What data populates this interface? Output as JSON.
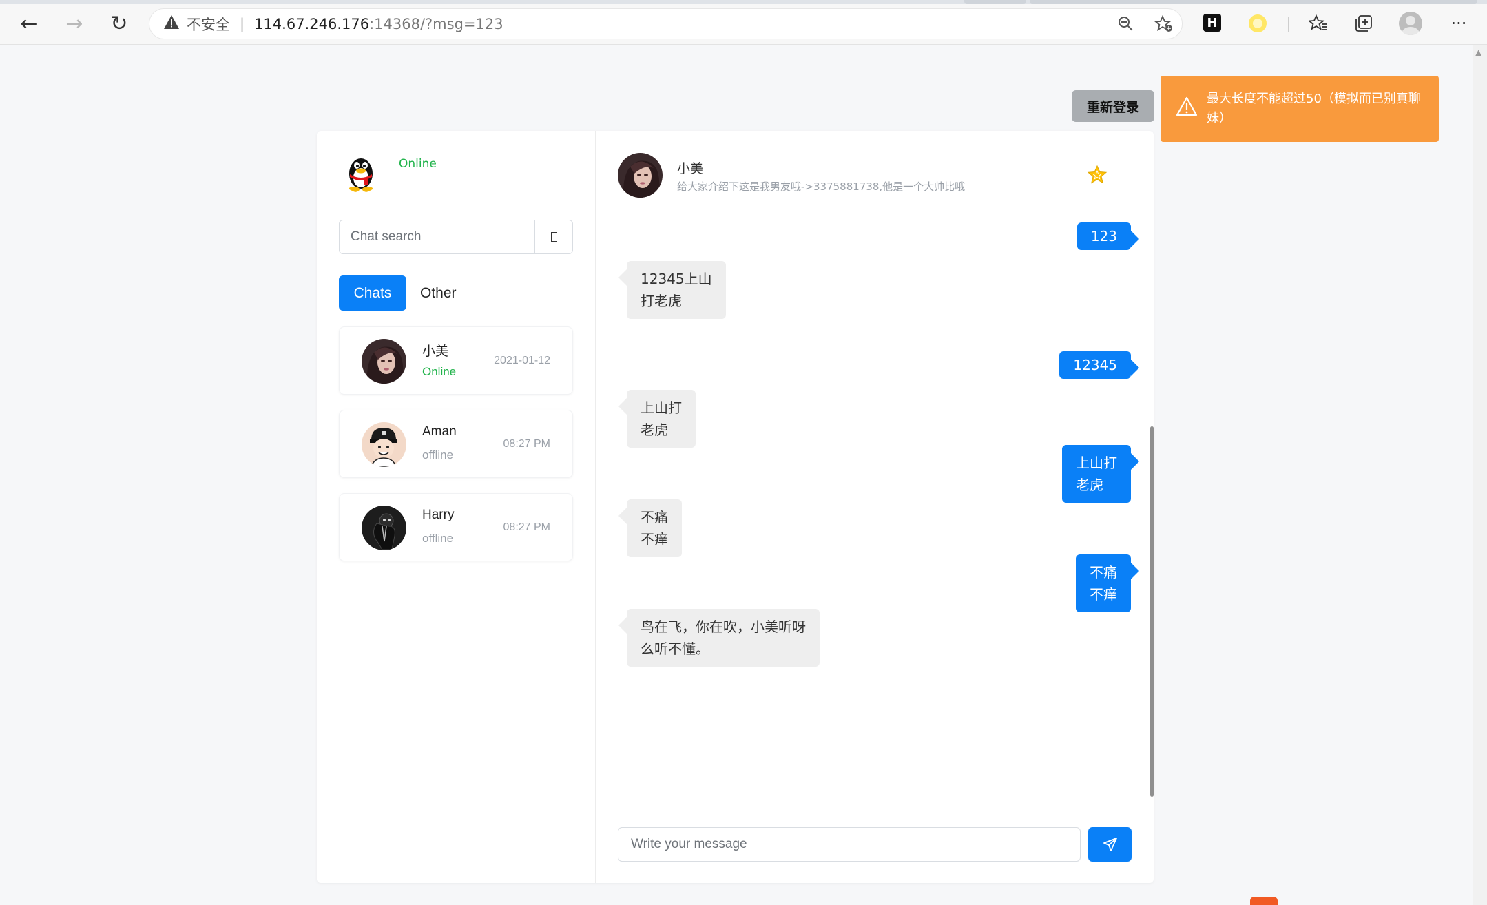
{
  "browser": {
    "nav": {
      "back": "←",
      "forward": "→",
      "reload": "↻"
    },
    "address": {
      "insecure_label": "不安全",
      "separator": "|",
      "host": "114.67.246.176",
      "path": ":14368/?msg=123"
    },
    "icons": [
      "zoom-icon",
      "add-favorite-icon",
      "h-extension-icon",
      "yellow-extension-icon",
      "favorites-icon",
      "collections-icon",
      "profile-icon",
      "more-icon"
    ]
  },
  "relogin_label": "重新登录",
  "toast": {
    "text": "最大长度不能超过50（模拟而已别真聊妹）"
  },
  "me": {
    "status": "Online"
  },
  "search": {
    "placeholder": "Chat search"
  },
  "tabs": [
    {
      "label": "Chats"
    },
    {
      "label": "Other"
    }
  ],
  "contacts": [
    {
      "name": "小美",
      "status": "Online",
      "time": "2021-01-12"
    },
    {
      "name": "Aman",
      "status": "offline",
      "time": "08:27 PM"
    },
    {
      "name": "Harry",
      "status": "offline",
      "time": "08:27 PM"
    }
  ],
  "chat": {
    "name": "小美",
    "signature": "给大家介绍下这是我男友哦->3375881738,他是一个大帅比哦",
    "messages": [
      {
        "dir": "out",
        "text": "123"
      },
      {
        "dir": "in",
        "text": "12345上山\n打老虎"
      },
      {
        "dir": "out",
        "text": "12345"
      },
      {
        "dir": "in",
        "text": "上山打\n老虎"
      },
      {
        "dir": "out",
        "text": "上山打\n老虎"
      },
      {
        "dir": "in",
        "text": "不痛\n不痒"
      },
      {
        "dir": "out",
        "text": "不痛\n不痒"
      },
      {
        "dir": "in",
        "text": "鸟在飞，你在吹，小美听呀\n么听不懂。"
      }
    ]
  },
  "composer": {
    "placeholder": "Write your message"
  },
  "colors": {
    "accent": "#0a80f7",
    "online": "#21b34b",
    "toast": "#f99a3d",
    "relogin": "#a9adb1"
  }
}
